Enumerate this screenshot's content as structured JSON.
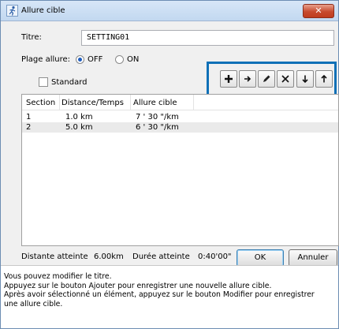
{
  "window": {
    "title": "Allure cible",
    "close_glyph": "✕"
  },
  "form": {
    "titre_label": "Titre:",
    "titre_value": "SETTING01",
    "plage_label": "Plage allure:",
    "plage_options": [
      {
        "label": "OFF",
        "checked": true
      },
      {
        "label": "ON",
        "checked": false
      }
    ],
    "standard_label": "Standard",
    "standard_checked": false
  },
  "toolbar": {
    "accent_color": "#0f70b7",
    "buttons": [
      {
        "name": "add-button",
        "icon": "plus-icon"
      },
      {
        "name": "insert-button",
        "icon": "arrow-right-icon"
      },
      {
        "name": "edit-button",
        "icon": "pencil-icon"
      },
      {
        "name": "delete-button",
        "icon": "x-icon"
      },
      {
        "name": "move-down-button",
        "icon": "arrow-down-icon"
      },
      {
        "name": "move-up-button",
        "icon": "arrow-up-icon"
      }
    ]
  },
  "table": {
    "columns": [
      "Section",
      "Distance/Temps",
      "Allure cible"
    ],
    "rows": [
      {
        "section": "1",
        "distance": "1.0 km",
        "allure": "7 ' 30 \"/km"
      },
      {
        "section": "2",
        "distance": "5.0 km",
        "allure": "6 ' 30 \"/km"
      }
    ]
  },
  "footer": {
    "distance_label": "Distante atteinte",
    "distance_value": "6.00km",
    "duree_label": "Durée atteinte",
    "duree_value": "0:40'00\"",
    "ok_label": "OK",
    "cancel_label": "Annuler"
  },
  "help": {
    "lines": [
      "Vous pouvez modifier le titre.",
      "Appuyez sur le bouton Ajouter pour enregistrer une nouvelle allure cible.",
      "Après avoir sélectionné un élément, appuyez sur le bouton Modifier pour enregistrer",
      "une allure cible."
    ]
  }
}
